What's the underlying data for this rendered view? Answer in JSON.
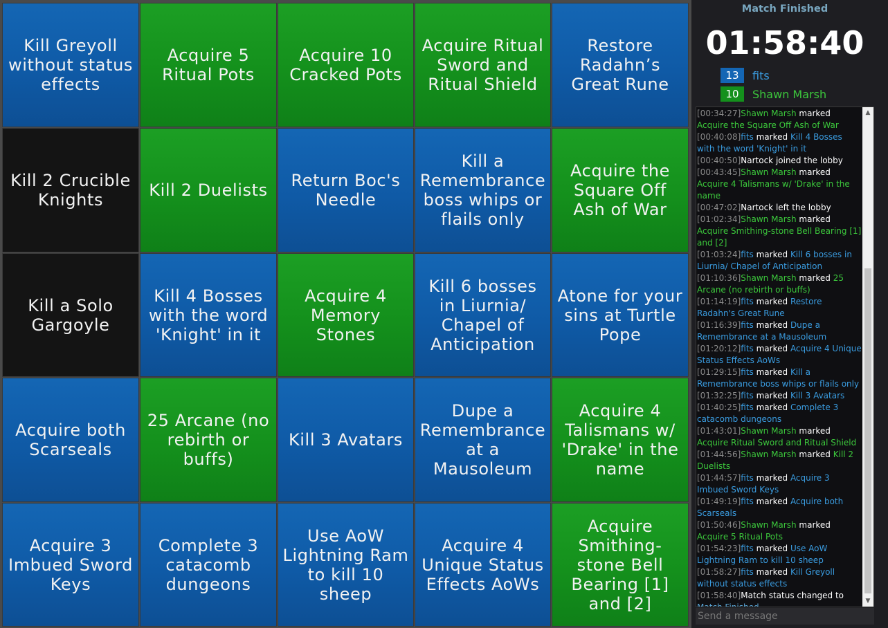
{
  "board": {
    "cells": [
      {
        "label": "Kill Greyoll without status effects",
        "owner": "blue"
      },
      {
        "label": "Acquire 5 Ritual Pots",
        "owner": "green"
      },
      {
        "label": "Acquire 10 Cracked Pots",
        "owner": "green"
      },
      {
        "label": "Acquire Ritual Sword and Ritual Shield",
        "owner": "green"
      },
      {
        "label": "Restore Radahn’s Great Rune",
        "owner": "blue"
      },
      {
        "label": "Kill 2 Crucible Knights",
        "owner": "none"
      },
      {
        "label": "Kill 2 Duelists",
        "owner": "green"
      },
      {
        "label": "Return Boc's Needle",
        "owner": "blue"
      },
      {
        "label": "Kill a Remembrance boss whips or flails only",
        "owner": "blue"
      },
      {
        "label": "Acquire the Square Off Ash of War",
        "owner": "green"
      },
      {
        "label": "Kill a Solo Gargoyle",
        "owner": "none"
      },
      {
        "label": "Kill 4 Bosses with the word 'Knight' in it",
        "owner": "blue"
      },
      {
        "label": "Acquire 4 Memory Stones",
        "owner": "green"
      },
      {
        "label": "Kill 6 bosses in Liurnia/ Chapel of Anticipation",
        "owner": "blue"
      },
      {
        "label": "Atone for your sins at Turtle Pope",
        "owner": "blue"
      },
      {
        "label": "Acquire both Scarseals",
        "owner": "blue"
      },
      {
        "label": "25 Arcane (no rebirth or buffs)",
        "owner": "green"
      },
      {
        "label": "Kill 3 Avatars",
        "owner": "blue"
      },
      {
        "label": "Dupe a Remembrance at a Mausoleum",
        "owner": "blue"
      },
      {
        "label": "Acquire 4 Talismans w/ 'Drake' in the name",
        "owner": "green"
      },
      {
        "label": "Acquire 3 Imbued Sword Keys",
        "owner": "blue"
      },
      {
        "label": "Complete 3 catacomb dungeons",
        "owner": "blue"
      },
      {
        "label": "Use AoW Lightning Ram to kill 10 sheep",
        "owner": "blue"
      },
      {
        "label": "Acquire 4 Unique Status Effects AoWs",
        "owner": "blue"
      },
      {
        "label": "Acquire Smithing-stone Bell Bearing [1] and [2]",
        "owner": "green"
      }
    ]
  },
  "match": {
    "status": "Match Finished",
    "timer": "01:58:40",
    "teams": [
      {
        "count": "13",
        "name": "fits",
        "color": "#1466b4"
      },
      {
        "count": "10",
        "name": "Shawn Marsh",
        "color": "#14901c"
      }
    ]
  },
  "chat": {
    "lines": [
      {
        "ts": "[00:34:27]",
        "player": "Shawn Marsh",
        "team": "green",
        "action": "marked",
        "object": "Acquire the Square Off Ash of War"
      },
      {
        "ts": "[00:40:08]",
        "player": "fits",
        "team": "blue",
        "action": "marked",
        "object": "Kill 4 Bosses with the word 'Knight' in it"
      },
      {
        "ts": "[00:40:50]",
        "player": "",
        "team": "sys",
        "action": "Nartock joined the lobby",
        "object": ""
      },
      {
        "ts": "[00:43:45]",
        "player": "Shawn Marsh",
        "team": "green",
        "action": "marked",
        "object": "Acquire 4 Talismans w/ 'Drake' in the name"
      },
      {
        "ts": "[00:47:02]",
        "player": "",
        "team": "sys",
        "action": "Nartock left the lobby",
        "object": ""
      },
      {
        "ts": "[01:02:34]",
        "player": "Shawn Marsh",
        "team": "green",
        "action": "marked",
        "object": "Acquire Smithing-stone Bell Bearing [1] and [2]"
      },
      {
        "ts": "[01:03:24]",
        "player": "fits",
        "team": "blue",
        "action": "marked",
        "object": "Kill 6 bosses in Liurnia/ Chapel of Anticipation"
      },
      {
        "ts": "[01:10:36]",
        "player": "Shawn Marsh",
        "team": "green",
        "action": "marked",
        "object": "25 Arcane (no rebirth or buffs)"
      },
      {
        "ts": "[01:14:19]",
        "player": "fits",
        "team": "blue",
        "action": "marked",
        "object": "Restore Radahn's Great Rune"
      },
      {
        "ts": "[01:16:39]",
        "player": "fits",
        "team": "blue",
        "action": "marked",
        "object": "Dupe a Remembrance at a Mausoleum"
      },
      {
        "ts": "[01:20:12]",
        "player": "fits",
        "team": "blue",
        "action": "marked",
        "object": "Acquire 4 Unique Status Effects AoWs"
      },
      {
        "ts": "[01:29:15]",
        "player": "fits",
        "team": "blue",
        "action": "marked",
        "object": "Kill a Remembrance boss whips or flails only"
      },
      {
        "ts": "[01:32:25]",
        "player": "fits",
        "team": "blue",
        "action": "marked",
        "object": "Kill 3 Avatars"
      },
      {
        "ts": "[01:40:25]",
        "player": "fits",
        "team": "blue",
        "action": "marked",
        "object": "Complete 3 catacomb dungeons"
      },
      {
        "ts": "[01:43:01]",
        "player": "Shawn Marsh",
        "team": "green",
        "action": "marked",
        "object": "Acquire Ritual Sword and Ritual Shield"
      },
      {
        "ts": "[01:44:56]",
        "player": "Shawn Marsh",
        "team": "green",
        "action": "marked",
        "object": "Kill 2 Duelists"
      },
      {
        "ts": "[01:44:57]",
        "player": "fits",
        "team": "blue",
        "action": "marked",
        "object": "Acquire 3 Imbued Sword Keys"
      },
      {
        "ts": "[01:49:19]",
        "player": "fits",
        "team": "blue",
        "action": "marked",
        "object": "Acquire both Scarseals"
      },
      {
        "ts": "[01:50:46]",
        "player": "Shawn Marsh",
        "team": "green",
        "action": "marked",
        "object": "Acquire 5 Ritual Pots"
      },
      {
        "ts": "[01:54:23]",
        "player": "fits",
        "team": "blue",
        "action": "marked",
        "object": "Use AoW Lightning Ram to kill 10 sheep"
      },
      {
        "ts": "[01:58:27]",
        "player": "fits",
        "team": "blue",
        "action": "marked",
        "object": "Kill Greyoll without status effects"
      },
      {
        "ts": "[01:58:40]",
        "player": "",
        "team": "sys",
        "action": "Match status changed to",
        "object": "Match Finished"
      }
    ],
    "input_placeholder": "Send a message",
    "scroll_up_icon": "arrow-up-icon",
    "scroll_down_icon": "arrow-down-icon"
  }
}
